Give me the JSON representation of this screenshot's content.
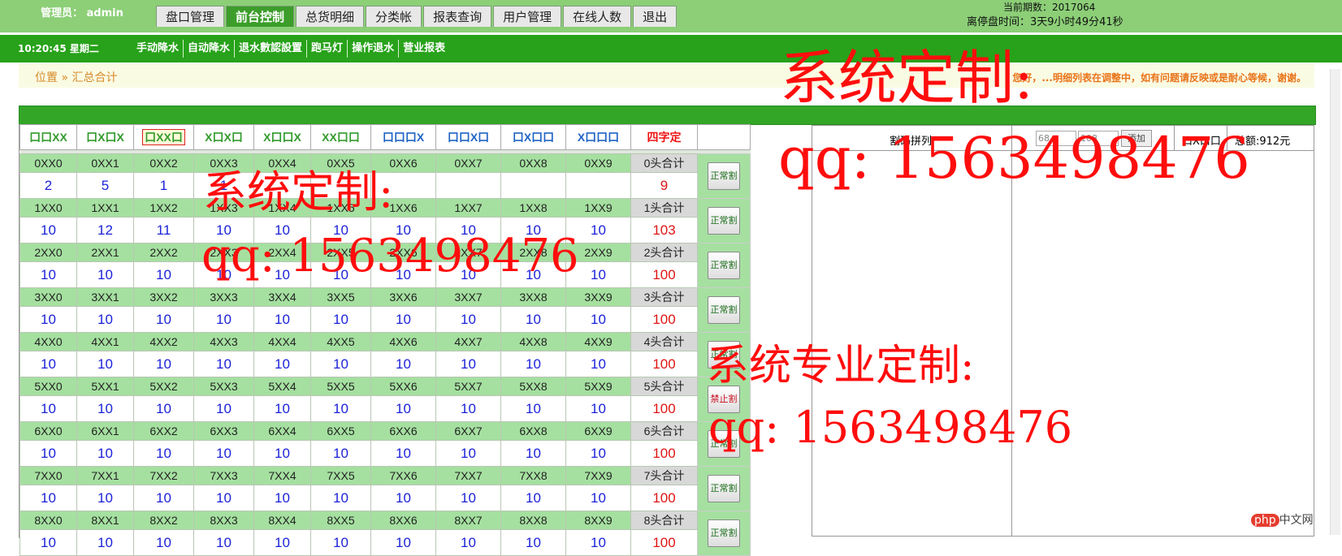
{
  "header": {
    "admin_label": "管理员： admin",
    "period_text": "当前期数：2017064",
    "countdown_text": "离停盘时间：3天9小时49分41秒",
    "tabs": [
      {
        "label": "盘口管理",
        "active": false
      },
      {
        "label": "前台控制",
        "active": true
      },
      {
        "label": "总货明细",
        "active": false
      },
      {
        "label": "分类帐",
        "active": false
      },
      {
        "label": "报表查询",
        "active": false
      },
      {
        "label": "用户管理",
        "active": false
      },
      {
        "label": "在线人数",
        "active": false
      },
      {
        "label": "退出",
        "active": false
      }
    ]
  },
  "subnav": {
    "clock": "10:20:45 星期二",
    "items": [
      "手动降水",
      "自动降水",
      "退水數認設置",
      "跑马灯",
      "操作退水",
      "营业报表"
    ]
  },
  "breadcrumb": {
    "text": "位置 » 汇总合计",
    "notice": "您好，...明细列表在调整中，如有问题请反映或是耐心等候，谢谢。"
  },
  "grid": {
    "headers": [
      "口口XX",
      "口X口X",
      "口XX口",
      "X口X口",
      "X口口X",
      "XX口口",
      "口口口X",
      "口口X口",
      "口X口口",
      "X口口口",
      "四字定"
    ],
    "header_colors": [
      "green",
      "green",
      "boxed",
      "green",
      "green",
      "green",
      "blue",
      "blue",
      "blue",
      "blue",
      "red"
    ],
    "rows": [
      {
        "labels": [
          "0XX0",
          "0XX1",
          "0XX2",
          "0XX3",
          "0XX4",
          "0XX5",
          "0XX6",
          "0XX7",
          "0XX8",
          "0XX9",
          "0头合计"
        ],
        "values": [
          "2",
          "5",
          "1",
          "1",
          "",
          "",
          "",
          "",
          "",
          "",
          "9"
        ],
        "button": "正常割"
      },
      {
        "labels": [
          "1XX0",
          "1XX1",
          "1XX2",
          "1XX3",
          "1XX4",
          "1XX5",
          "1XX6",
          "1XX7",
          "1XX8",
          "1XX9",
          "1头合计"
        ],
        "values": [
          "10",
          "12",
          "11",
          "10",
          "10",
          "10",
          "10",
          "10",
          "10",
          "10",
          "103"
        ],
        "button": "正常割"
      },
      {
        "labels": [
          "2XX0",
          "2XX1",
          "2XX2",
          "2XX3",
          "2XX4",
          "2XX5",
          "2XX6",
          "2XX7",
          "2XX8",
          "2XX9",
          "2头合计"
        ],
        "values": [
          "10",
          "10",
          "10",
          "10",
          "10",
          "10",
          "10",
          "10",
          "10",
          "10",
          "100"
        ],
        "button": "正常割"
      },
      {
        "labels": [
          "3XX0",
          "3XX1",
          "3XX2",
          "3XX3",
          "3XX4",
          "3XX5",
          "3XX6",
          "3XX7",
          "3XX8",
          "3XX9",
          "3头合计"
        ],
        "values": [
          "10",
          "10",
          "10",
          "10",
          "10",
          "10",
          "10",
          "10",
          "10",
          "10",
          "100"
        ],
        "button": "正常割"
      },
      {
        "labels": [
          "4XX0",
          "4XX1",
          "4XX2",
          "4XX3",
          "4XX4",
          "4XX5",
          "4XX6",
          "4XX7",
          "4XX8",
          "4XX9",
          "4头合计"
        ],
        "values": [
          "10",
          "10",
          "10",
          "10",
          "10",
          "10",
          "10",
          "10",
          "10",
          "10",
          "100"
        ],
        "button": "正常割"
      },
      {
        "labels": [
          "5XX0",
          "5XX1",
          "5XX2",
          "5XX3",
          "5XX4",
          "5XX5",
          "5XX6",
          "5XX7",
          "5XX8",
          "5XX9",
          "5头合计"
        ],
        "values": [
          "10",
          "10",
          "10",
          "10",
          "10",
          "10",
          "10",
          "10",
          "10",
          "10",
          "100"
        ],
        "button": "禁止割"
      },
      {
        "labels": [
          "6XX0",
          "6XX1",
          "6XX2",
          "6XX3",
          "6XX4",
          "6XX5",
          "6XX6",
          "6XX7",
          "6XX8",
          "6XX9",
          "6头合计"
        ],
        "values": [
          "10",
          "10",
          "10",
          "10",
          "10",
          "10",
          "10",
          "10",
          "10",
          "10",
          "100"
        ],
        "button": "正常割"
      },
      {
        "labels": [
          "7XX0",
          "7XX1",
          "7XX2",
          "7XX3",
          "7XX4",
          "7XX5",
          "7XX6",
          "7XX7",
          "7XX8",
          "7XX9",
          "7头合计"
        ],
        "values": [
          "10",
          "10",
          "10",
          "10",
          "10",
          "10",
          "10",
          "10",
          "10",
          "10",
          "100"
        ],
        "button": "正常割"
      },
      {
        "labels": [
          "8XX0",
          "8XX1",
          "8XX2",
          "8XX3",
          "8XX4",
          "8XX5",
          "8XX6",
          "8XX7",
          "8XX8",
          "8XX9",
          "8头合计"
        ],
        "values": [
          "10",
          "10",
          "10",
          "10",
          "10",
          "10",
          "10",
          "10",
          "10",
          "10",
          "100"
        ],
        "button": "正常割"
      }
    ]
  },
  "right_panel": {
    "split_label": "割码拼列",
    "select1": "68",
    "select2": "108",
    "add_button": "添加",
    "digits_label": "口X口口",
    "total_label": "总额:912元"
  },
  "watermarks": {
    "title": "系统定制:",
    "qq": "qq: 1563498476",
    "title2": "系统定制:",
    "qq2": "qq: 1563498476",
    "title3": "系统专业定制:",
    "qq3": "qq: 1563498476"
  },
  "footer_logo": {
    "badge": "php",
    "text": "中文网"
  }
}
